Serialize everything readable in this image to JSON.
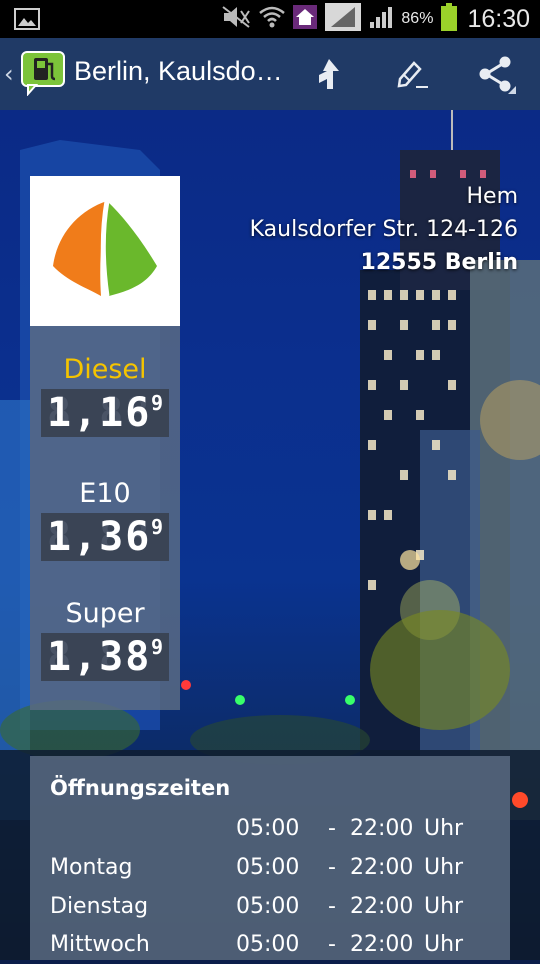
{
  "status_bar": {
    "battery_percent": "86%",
    "time": "16:30"
  },
  "action_bar": {
    "title": "Berlin, Kaulsdo…",
    "back_icon": "chevron-left-icon",
    "app_icon": "fuel-pump-chat-icon",
    "actions": [
      "navigate-icon",
      "edit-icon",
      "share-icon"
    ]
  },
  "station": {
    "brand": "Hem",
    "street": "Kaulsdorfer Str. 124-126",
    "city": "12555 Berlin",
    "logo_colors": {
      "orange": "#f07c1a",
      "green": "#6ab82c"
    }
  },
  "prices": [
    {
      "fuel": "Diesel",
      "price": "1,16",
      "superscript": "9",
      "highlight": true
    },
    {
      "fuel": "E10",
      "price": "1,36",
      "superscript": "9",
      "highlight": false
    },
    {
      "fuel": "Super",
      "price": "1,38",
      "superscript": "9",
      "highlight": false
    }
  ],
  "hours": {
    "title": "Öffnungszeiten",
    "rows": [
      {
        "day": "",
        "from": "05:00",
        "dash": "-",
        "to": "22:00",
        "unit": "Uhr"
      },
      {
        "day": "Montag",
        "from": "05:00",
        "dash": "-",
        "to": "22:00",
        "unit": "Uhr"
      },
      {
        "day": "Dienstag",
        "from": "05:00",
        "dash": "-",
        "to": "22:00",
        "unit": "Uhr"
      },
      {
        "day": "Mittwoch",
        "from": "05:00",
        "dash": "-",
        "to": "22:00",
        "unit": "Uhr"
      }
    ]
  },
  "colors": {
    "action_bar": "#203a66",
    "diesel_label": "#f5c400",
    "panel": "#5c6c84"
  }
}
